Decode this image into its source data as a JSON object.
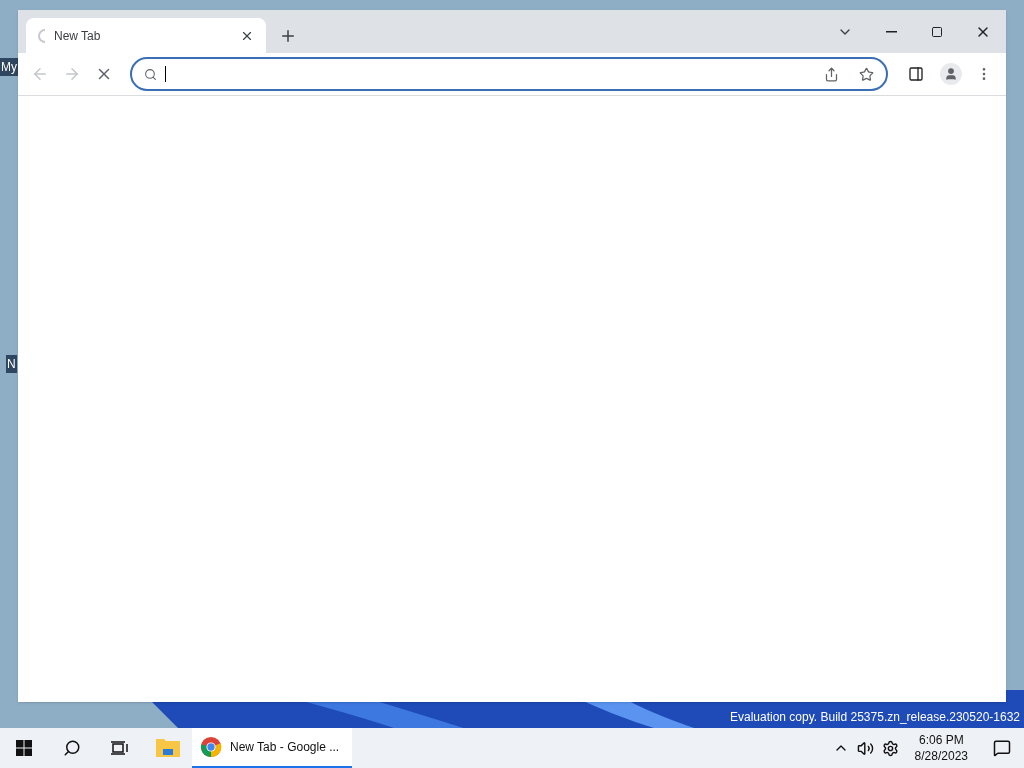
{
  "desktop": {
    "icon_labels": [
      "My",
      "N"
    ],
    "watermark": "Evaluation copy. Build 25375.zn_release.230520-1632"
  },
  "browser": {
    "tabs": [
      {
        "title": "New Tab",
        "selected": true,
        "loading": true
      }
    ],
    "navigation": {
      "back_enabled": false,
      "forward_enabled": false,
      "loading": true
    },
    "address_bar": {
      "focused": true
    }
  },
  "taskbar": {
    "apps": [
      {
        "kind": "folder",
        "active": false
      },
      {
        "kind": "browser",
        "label": "New Tab - Google ...",
        "active": true
      }
    ],
    "clock": {
      "time": "6:06 PM",
      "date": "8/28/2023"
    }
  }
}
